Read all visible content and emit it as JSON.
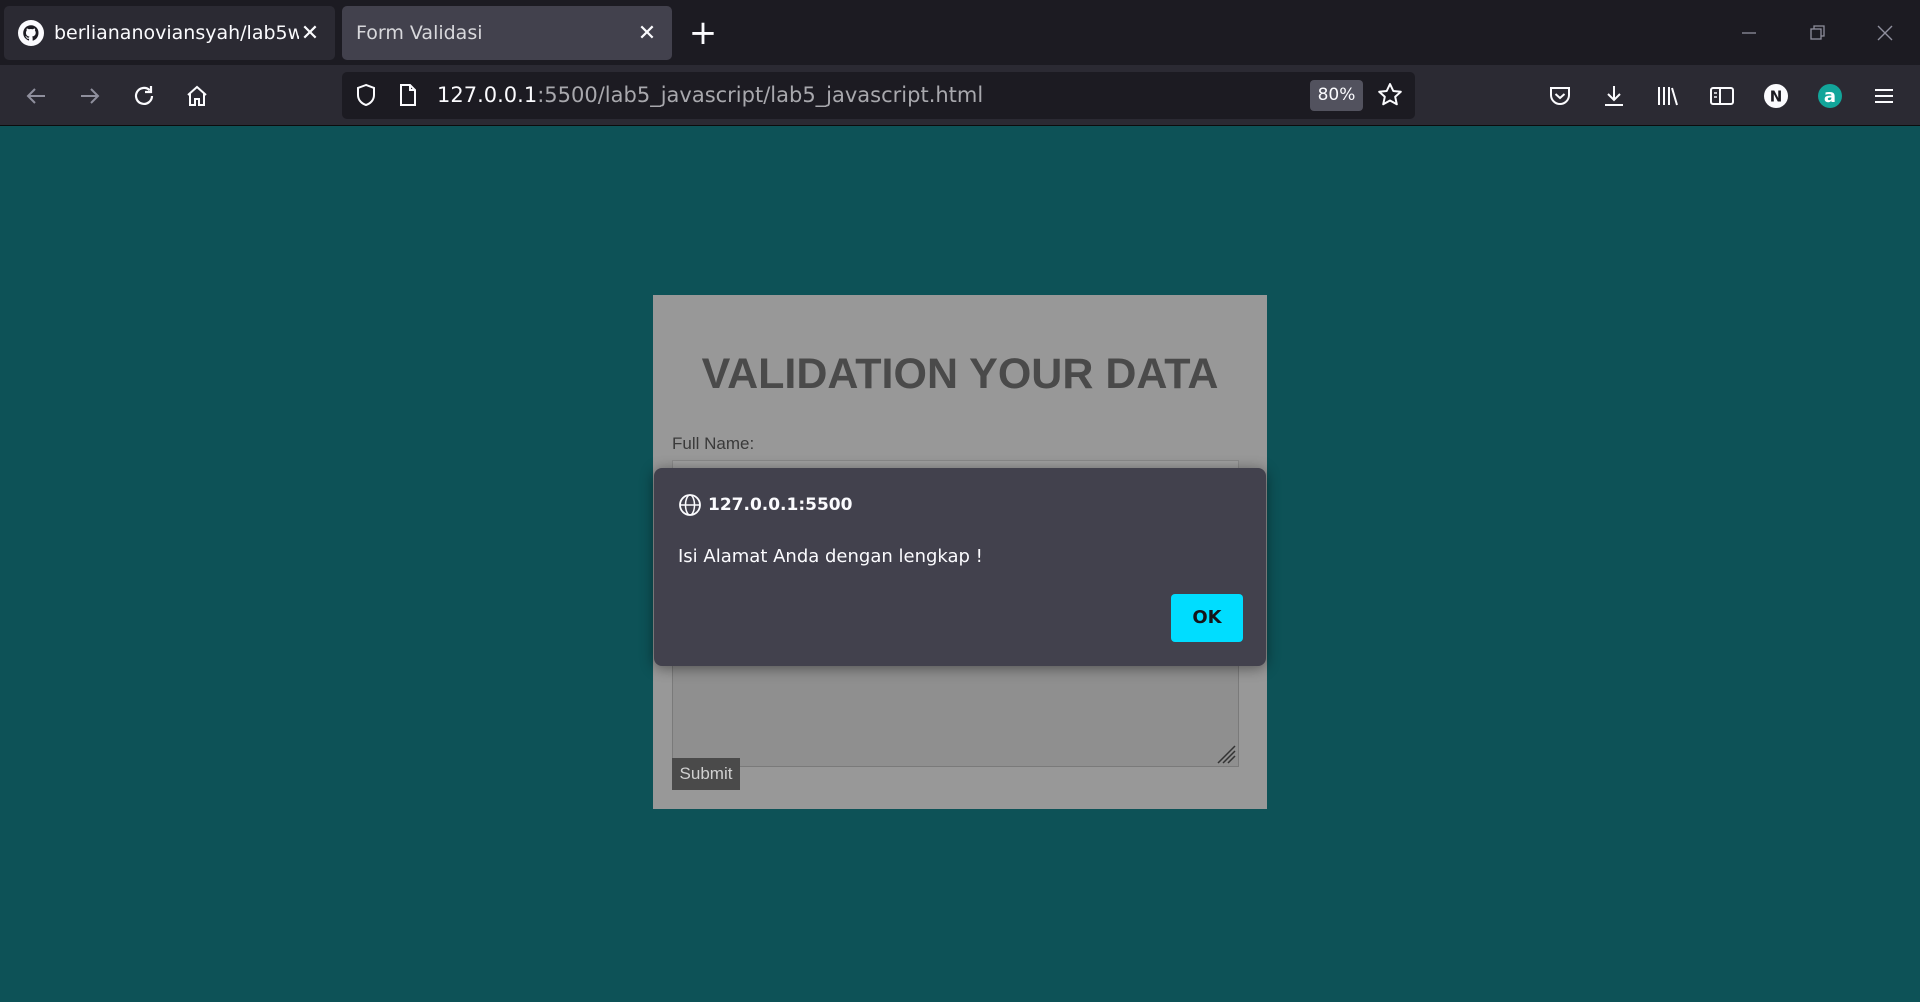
{
  "browser": {
    "tabs": [
      {
        "label": "berliananoviansyah/lab5web",
        "favicon": "github-icon",
        "active": false
      },
      {
        "label": "Form Validasi",
        "active": true
      }
    ],
    "url": {
      "host": "127.0.0.1",
      "rest": ":5500/lab5_javascript/lab5_javascript.html"
    },
    "zoom": "80%",
    "profile_letter": "N",
    "extension_letter": "a"
  },
  "page": {
    "title": "VALIDATION YOUR DATA",
    "fullname_label": "Full Name:",
    "submit_label": "Submit"
  },
  "dialog": {
    "origin": "127.0.0.1:5500",
    "message": "Isi Alamat Anda dengan lengkap !",
    "ok_label": "OK"
  },
  "colors": {
    "page_bg": "#0d5257",
    "accent": "#00ddff",
    "dialog_bg": "#42414d"
  }
}
